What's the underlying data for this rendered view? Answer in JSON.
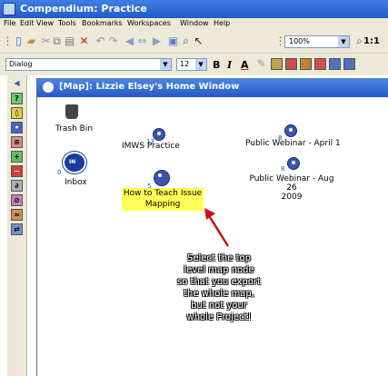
{
  "window": {
    "title": "Compendium: Practice"
  },
  "menu": [
    "File",
    "Edit",
    "View",
    "Tools",
    "Bookmarks",
    "Workspaces",
    "Window",
    "Help"
  ],
  "toolbar": {
    "zoom_value": "100%",
    "zoom_label": "1:1"
  },
  "format_bar": {
    "style_value": "Dialog",
    "size_value": "12",
    "bold": "B",
    "italic": "I",
    "underline": "A"
  },
  "map": {
    "title": "[Map]:  Lizzie Elsey's Home Window"
  },
  "nodes": {
    "trash": {
      "label": "Trash Bin"
    },
    "inbox": {
      "label": "Inbox",
      "count": "0"
    },
    "imws": {
      "label": "IMWS Practice",
      "count": "13"
    },
    "webinar_april": {
      "label": "Public Webinar - April 1",
      "count": "8"
    },
    "webinar_aug": {
      "label_line1": "Public Webinar - Aug 26",
      "label_line2": "2009",
      "count": "8"
    },
    "teach": {
      "label_line1": "How to Teach Issue",
      "label_line2": "Mapping",
      "count": "5"
    }
  },
  "annotation": {
    "lines": [
      "Select the top",
      "level map node",
      "so that you export",
      "the whole map,",
      "but not your",
      "whole Project!"
    ]
  },
  "colors": {
    "title_bar": "#2559c8",
    "highlight": "#ffff55",
    "arrow": "#cc1111",
    "node": "#3a55b0"
  }
}
